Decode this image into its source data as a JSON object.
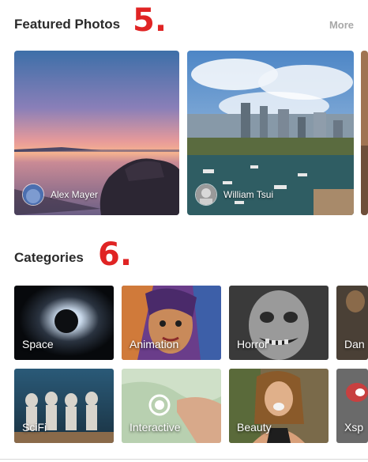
{
  "featured": {
    "title": "Featured Photos",
    "marker": "5.",
    "more_label": "More",
    "photos": [
      {
        "author": "Alex Mayer"
      },
      {
        "author": "William Tsui"
      }
    ]
  },
  "categories": {
    "title": "Categories",
    "marker": "6.",
    "items": [
      {
        "label": "Space"
      },
      {
        "label": "Animation"
      },
      {
        "label": "Horror"
      },
      {
        "label": "Dan"
      },
      {
        "label": "SciFi"
      },
      {
        "label": "Interactive"
      },
      {
        "label": "Beauty"
      },
      {
        "label": "Xsp"
      }
    ]
  },
  "colors": {
    "marker": "#e02424",
    "title_text": "#2b2b2b",
    "more_text": "#a8a8a8"
  }
}
